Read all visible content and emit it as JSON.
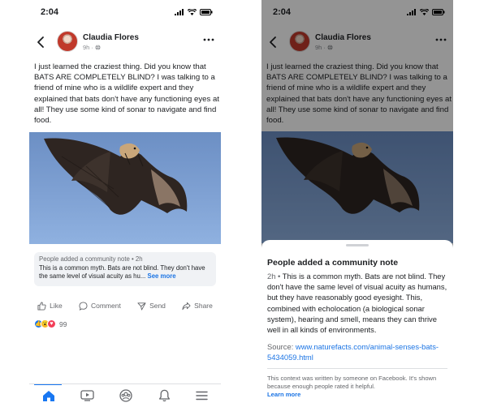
{
  "status_bar": {
    "time": "2:04"
  },
  "post": {
    "author": "Claudia Flores",
    "time": "9h",
    "text": "I just learned the craziest thing. Did you know that BATS ARE COMPLETELY BLIND? I was talking to a friend of mine who is a wildlife expert and they explained that bats don't have any functioning eyes at all! They use some kind of sonar to navigate and find food."
  },
  "community_note_preview": {
    "title": "People added a community note • 2h",
    "body": "This is a common myth. Bats are not blind. They don't have the same level of visual acuity as hu...",
    "see_more": "See more"
  },
  "actions": {
    "like": "Like",
    "comment": "Comment",
    "send": "Send",
    "share": "Share"
  },
  "reactions": {
    "count": "99"
  },
  "tabs": [
    "home-icon",
    "video-icon",
    "groups-icon",
    "bell-icon",
    "menu-icon"
  ],
  "note_sheet": {
    "title": "People added a community note",
    "time": "2h",
    "separator": " • ",
    "body": "This is a common myth. Bats are not blind. They don't have the same level of visual acuity as humans, but they have reasonably good eyesight. This, combined with echolocation (a biological sonar system), hearing and smell, means they can thrive well in all kinds of environments.",
    "source_label": "Source: ",
    "source_url": "www.naturefacts.com/animal-senses-bats-5434059.html",
    "footer": "This context was written by someone on Facebook. It's shown because enough people rated it helpful.",
    "learn_more": "Learn more"
  },
  "colors": {
    "accent": "#1877f2",
    "link": "#1b74e4",
    "note_bg": "#f0f2f5",
    "sky": "#7fa1d3"
  }
}
